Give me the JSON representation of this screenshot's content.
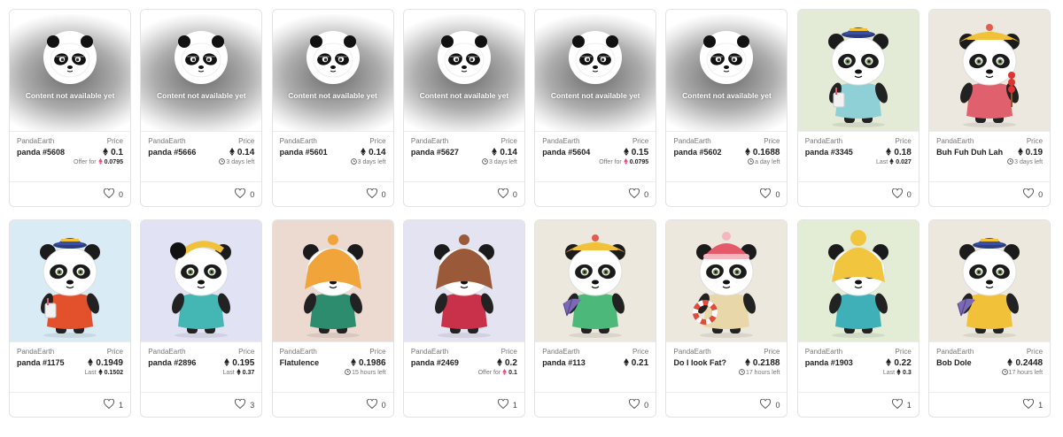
{
  "labels": {
    "collection": "PandaEarth",
    "price": "Price",
    "not_available": "Content not available yet"
  },
  "colors": {
    "accent_pink": "#e8497a",
    "text_dark": "#222222",
    "text_muted": "#777777"
  },
  "cards": [
    {
      "collection": "PandaEarth",
      "price_label": "Price",
      "name": "panda #5608",
      "price": "0.1",
      "sub_type": "offer",
      "sub_prefix": "Offer for",
      "sub_value": "0.0795",
      "likes": "0",
      "image": "not-available"
    },
    {
      "collection": "PandaEarth",
      "price_label": "Price",
      "name": "panda #5666",
      "price": "0.14",
      "sub_type": "time",
      "sub_prefix": "",
      "sub_value": "3 days left",
      "likes": "0",
      "image": "not-available"
    },
    {
      "collection": "PandaEarth",
      "price_label": "Price",
      "name": "panda #5601",
      "price": "0.14",
      "sub_type": "time",
      "sub_prefix": "",
      "sub_value": "3 days left",
      "likes": "0",
      "image": "not-available"
    },
    {
      "collection": "PandaEarth",
      "price_label": "Price",
      "name": "panda #5627",
      "price": "0.14",
      "sub_type": "time",
      "sub_prefix": "",
      "sub_value": "3 days left",
      "likes": "0",
      "image": "not-available"
    },
    {
      "collection": "PandaEarth",
      "price_label": "Price",
      "name": "panda #5604",
      "price": "0.15",
      "sub_type": "offer",
      "sub_prefix": "Offer for",
      "sub_value": "0.0795",
      "likes": "0",
      "image": "not-available"
    },
    {
      "collection": "PandaEarth",
      "price_label": "Price",
      "name": "panda #5602",
      "price": "0.1688",
      "sub_type": "time",
      "sub_prefix": "",
      "sub_value": "a day left",
      "likes": "0",
      "image": "not-available"
    },
    {
      "collection": "PandaEarth",
      "price_label": "Price",
      "name": "panda #3345",
      "price": "0.18",
      "sub_type": "last",
      "sub_prefix": "Last",
      "sub_value": "0.027",
      "likes": "0",
      "image": "panda",
      "bg": "#e3ead5",
      "hat": "sailor",
      "hat_color": "#3a4fa0",
      "outfit": "#8fcfd6",
      "prop": "cup"
    },
    {
      "collection": "PandaEarth",
      "price_label": "Price",
      "name": "Buh Fuh Duh Lah",
      "price": "0.19",
      "sub_type": "time",
      "sub_prefix": "",
      "sub_value": "3 days left",
      "likes": "0",
      "image": "panda",
      "bg": "#ece8df",
      "hat": "wide",
      "hat_color": "#f2c13a",
      "outfit": "#e1606d",
      "prop": "stick"
    },
    {
      "collection": "PandaEarth",
      "price_label": "Price",
      "name": "panda #1175",
      "price": "0.1949",
      "sub_type": "last",
      "sub_prefix": "Last",
      "sub_value": "0.1502",
      "likes": "1",
      "image": "panda",
      "bg": "#d9ebf4",
      "hat": "sailor",
      "hat_color": "#3a4fa0",
      "outfit": "#e2502c",
      "prop": "cup"
    },
    {
      "collection": "PandaEarth",
      "price_label": "Price",
      "name": "panda #2896",
      "price": "0.195",
      "sub_type": "last",
      "sub_prefix": "Last",
      "sub_value": "0.37",
      "likes": "3",
      "image": "panda",
      "bg": "#e1e2f4",
      "hat": "band",
      "hat_color": "#f2c13a",
      "outfit": "#44b6b3",
      "prop": "none"
    },
    {
      "collection": "PandaEarth",
      "price_label": "Price",
      "name": "Flatulence",
      "price": "0.1986",
      "sub_type": "time",
      "sub_prefix": "",
      "sub_value": "15 hours left",
      "likes": "0",
      "image": "panda",
      "bg": "#ecd9d0",
      "hat": "hair",
      "hat_color": "#f0a43a",
      "outfit": "#2d8c6e",
      "prop": "none"
    },
    {
      "collection": "PandaEarth",
      "price_label": "Price",
      "name": "panda #2469",
      "price": "0.2",
      "sub_type": "offer",
      "sub_prefix": "Offer for",
      "sub_value": "0.1",
      "likes": "1",
      "image": "panda",
      "bg": "#e3e3f2",
      "hat": "hair",
      "hat_color": "#9a5a3a",
      "outfit": "#c9304a",
      "prop": "none"
    },
    {
      "collection": "PandaEarth",
      "price_label": "Price",
      "name": "panda #113",
      "price": "0.21",
      "sub_type": "none",
      "sub_prefix": "",
      "sub_value": "",
      "likes": "0",
      "image": "panda",
      "bg": "#ece8dd",
      "hat": "wide",
      "hat_color": "#f2c13a",
      "outfit": "#4cb87a",
      "prop": "fan"
    },
    {
      "collection": "PandaEarth",
      "price_label": "Price",
      "name": "Do I look Fat?",
      "price": "0.2188",
      "sub_type": "time",
      "sub_prefix": "",
      "sub_value": "17 hours left",
      "likes": "0",
      "image": "panda",
      "bg": "#ece8dd",
      "hat": "beanie",
      "hat_color": "#e45a6a",
      "outfit": "#e8d7a8",
      "prop": "ring"
    },
    {
      "collection": "PandaEarth",
      "price_label": "Price",
      "name": "panda #1903",
      "price": "0.22",
      "sub_type": "last",
      "sub_prefix": "Last",
      "sub_value": "0.3",
      "likes": "1",
      "image": "panda",
      "bg": "#e3edd6",
      "hat": "bun",
      "hat_color": "#f2c53e",
      "outfit": "#3fb0b8",
      "prop": "none"
    },
    {
      "collection": "PandaEarth",
      "price_label": "Price",
      "name": "Bob Dole",
      "price": "0.2448",
      "sub_type": "time",
      "sub_prefix": "",
      "sub_value": "17 hours left",
      "likes": "1",
      "image": "panda",
      "bg": "#ece8dd",
      "hat": "sailor",
      "hat_color": "#3a4fa0",
      "outfit": "#f2c13a",
      "prop": "fan"
    }
  ]
}
